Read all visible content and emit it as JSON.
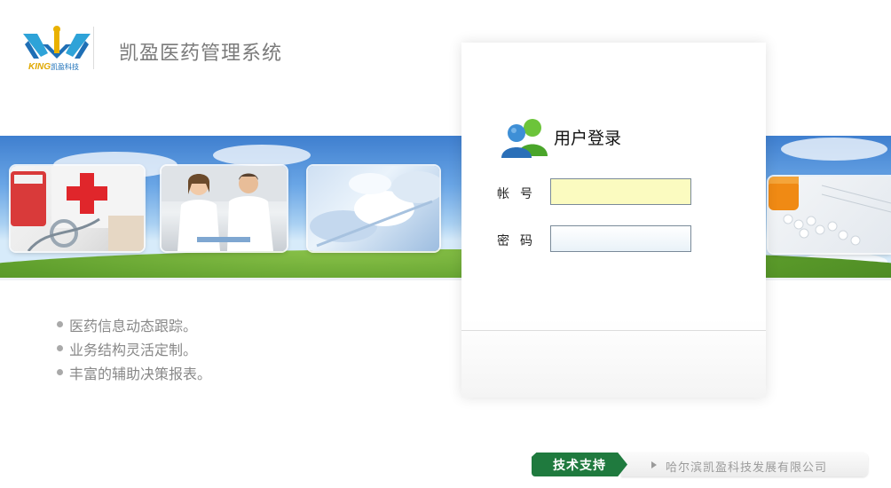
{
  "header": {
    "logo_brand": "KING",
    "logo_sub": "凯盈科技",
    "system_title": "凯盈医药管理系统"
  },
  "login": {
    "title": "用户登录",
    "account_label": "帐号",
    "password_label": "密码",
    "account_value": "",
    "password_value": ""
  },
  "features": [
    "医药信息动态跟踪。",
    "业务结构灵活定制。",
    "丰富的辅助决策报表。"
  ],
  "footer": {
    "support_label": "技术支持",
    "company": "哈尔滨凯盈科技发展有限公司"
  },
  "colors": {
    "account_bg": "#fbfbc0",
    "support_green": "#1f7a3e",
    "sky_blue": "#6aa6e6"
  }
}
